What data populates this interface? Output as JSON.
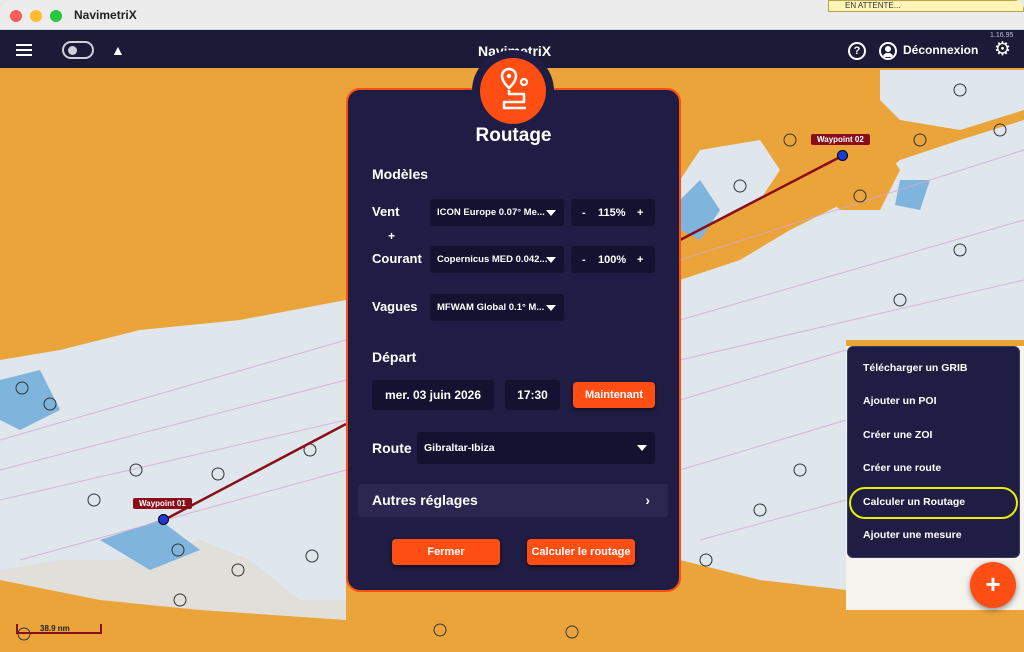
{
  "window": {
    "title": "NavimetriX",
    "pending_banner": "EN ATTENTE..."
  },
  "appbar": {
    "brand": "NavimetriX",
    "version": "1.16.95",
    "help_glyph": "?",
    "logout": "Déconnexion"
  },
  "map": {
    "scale_label": "38.9 nm",
    "waypoints": [
      {
        "label": "Waypoint 01"
      },
      {
        "label": "Waypoint 02"
      }
    ]
  },
  "dialog": {
    "title": "Routage",
    "models_title": "Modèles",
    "wind_label": "Vent",
    "plus_glyph": "+",
    "current_label": "Courant",
    "waves_label": "Vagues",
    "wind_model": "ICON Europe 0.07° Me...",
    "current_model": "Copernicus MED 0.042...",
    "waves_model": "MFWAM Global 0.1° M...",
    "wind_factor": "115%",
    "current_factor": "100%",
    "minus_glyph": "-",
    "stepper_plus_glyph": "+",
    "departure_title": "Départ",
    "departure_date": "mer. 03 juin 2026",
    "departure_time": "17:30",
    "now_button": "Maintenant",
    "route_label": "Route",
    "route_value": "Gibraltar-Ibiza",
    "other_settings": "Autres réglages",
    "close_button": "Fermer",
    "compute_button": "Calculer le routage"
  },
  "side_menu": {
    "items": [
      {
        "label": "Télécharger un GRIB"
      },
      {
        "label": "Ajouter un POI"
      },
      {
        "label": "Créer une ZOI"
      },
      {
        "label": "Créer une route"
      },
      {
        "label": "Calculer un Routage"
      },
      {
        "label": "Ajouter une mesure"
      }
    ],
    "fab_glyph": "+"
  },
  "colors": {
    "accent": "#ff4e14",
    "panel": "#201d44",
    "land": "#eaa43a",
    "sea": "#dfe6ec",
    "route": "#8a0e1a"
  },
  "icons": [
    "hamburger-icon",
    "toggle-switch",
    "navigation-arrow-icon",
    "help-icon",
    "user-icon",
    "gear-icon",
    "route-pin-icon",
    "chevron-down-icon",
    "chevron-right-icon",
    "plus-icon"
  ]
}
